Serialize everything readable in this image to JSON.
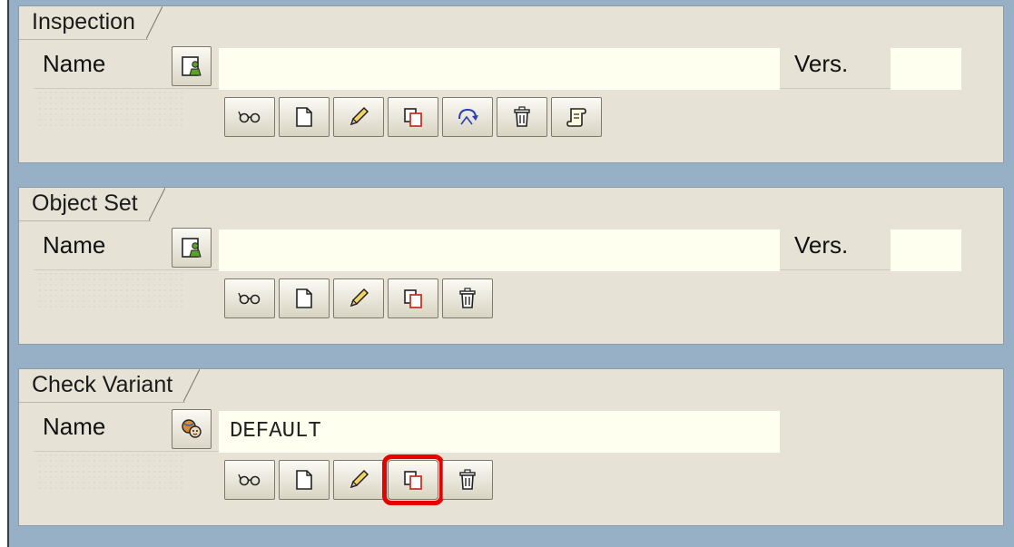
{
  "sections": [
    {
      "title": "Inspection",
      "name_label": "Name",
      "name_value": "",
      "vers_label": "Vers.",
      "vers_value": "",
      "buttons": [
        "display",
        "create",
        "change",
        "copy",
        "rename",
        "delete",
        "history"
      ]
    },
    {
      "title": "Object Set",
      "name_label": "Name",
      "name_value": "",
      "vers_label": "Vers.",
      "vers_value": "",
      "buttons": [
        "display",
        "create",
        "change",
        "copy",
        "delete"
      ]
    },
    {
      "title": "Check Variant",
      "name_label": "Name",
      "name_value": "DEFAULT",
      "buttons": [
        "display",
        "create",
        "change",
        "copy",
        "delete"
      ],
      "highlighted_button": "copy"
    }
  ],
  "icons": {
    "match_person": "person-document-icon",
    "match_global": "global-people-icon",
    "display": "glasses-icon",
    "create": "blank-page-icon",
    "change": "pencil-icon",
    "copy": "copy-icon",
    "rename": "rename-arrow-icon",
    "delete": "trash-icon",
    "history": "scroll-icon"
  },
  "colors": {
    "highlight": "#e60000",
    "panel_bg": "#e6e3d6",
    "frame_bg": "#97b0c5",
    "field_bg": "#fffff0"
  }
}
